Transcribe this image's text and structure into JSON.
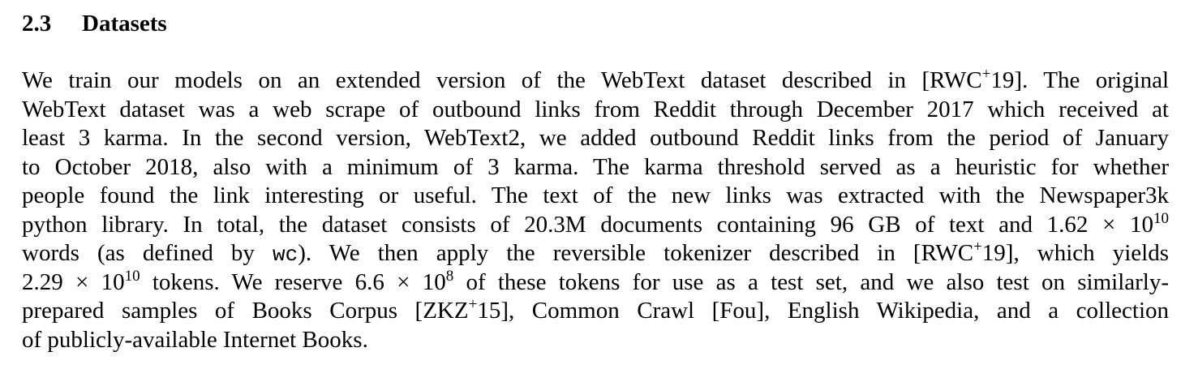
{
  "section": {
    "number": "2.3",
    "title": "Datasets"
  },
  "paragraph": {
    "l1a": "We train our models on an extended version of the WebText dataset described in [RWC",
    "l1sup": "+",
    "l1b": "19].  The original",
    "l2": "WebText dataset was a web scrape of outbound links from Reddit through December 2017 which received at",
    "l3": "least 3 karma. In the second version, WebText2, we added outbound Reddit links from the period of January",
    "l4": "to October 2018, also with a minimum of 3 karma.  The karma threshold served as a heuristic for whether",
    "l5": "people found the link interesting or useful.  The text of the new links was extracted with the Newspaper3k",
    "l6a": "python library. In total, the dataset consists of 20.3M documents containing 96 GB of text and 1.62 × 10",
    "l6sup": "10",
    "l7a": "words (as defined by ",
    "l7code": "wc",
    "l7b": ").  We then apply the reversible tokenizer described in [RWC",
    "l7sup": "+",
    "l7c": "19], which yields",
    "l8a": "2.29 × 10",
    "l8sup1": "10",
    "l8b": " tokens. We reserve 6.6 × 10",
    "l8sup2": "8",
    "l8c": " of these tokens for use as a test set, and we also test on similarly-",
    "l9a": "prepared samples of Books Corpus [ZKZ",
    "l9sup": "+",
    "l9b": "15], Common Crawl [Fou], English Wikipedia, and a collection",
    "l10": "of publicly-available Internet Books."
  }
}
